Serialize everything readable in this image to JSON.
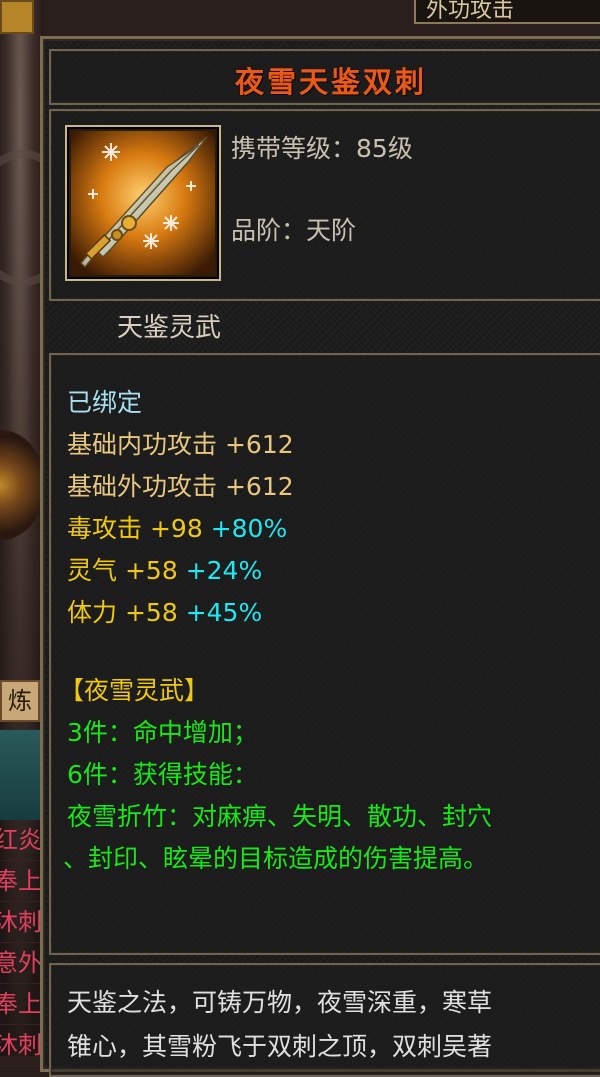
{
  "top_strip": {
    "label": "外功攻击"
  },
  "side": {
    "tab_label": "炼",
    "list": [
      "红炎",
      "奉上",
      "沐刺",
      "意外",
      "奉上",
      "沐刺"
    ]
  },
  "item": {
    "name": "夜雪天鉴双刺",
    "icon": "twin-daggers-snowflake-icon",
    "level_label": "携带等级：",
    "level_value": "85级",
    "grade_label": "品阶：",
    "grade_value": "天阶",
    "subtitle": "天鉴灵武"
  },
  "stats": {
    "bound": "已绑定",
    "base_inner": {
      "label": "基础内功攻击",
      "value": "+612"
    },
    "base_outer": {
      "label": "基础外功攻击",
      "value": "+612"
    },
    "poison": {
      "label": "毒攻击",
      "value": "+98",
      "pct": "+80%"
    },
    "spirit": {
      "label": "灵气",
      "value": "+58",
      "pct": "+24%"
    },
    "stamina": {
      "label": "体力",
      "value": "+58",
      "pct": "+45%"
    }
  },
  "set": {
    "name": "【夜雪灵武】",
    "bonus3": "3件：命中增加；",
    "bonus6": "6件：获得技能：",
    "skill_line1": "夜雪折竹：对麻痹、失明、散功、封穴",
    "skill_line2": "、封印、眩晕的目标造成的伤害提高。"
  },
  "description": {
    "line1": "天鉴之法，可铸万物，夜雪深重，寒草",
    "line2": "锥心，其雪粉飞于双刺之顶，双刺吴著"
  },
  "colors": {
    "title": "#e85a1a",
    "bound": "#a8e0f0",
    "base_stat": "#e8c880",
    "bonus_stat": "#f0c810",
    "percent": "#20e8f0",
    "set_text": "#18e818"
  }
}
